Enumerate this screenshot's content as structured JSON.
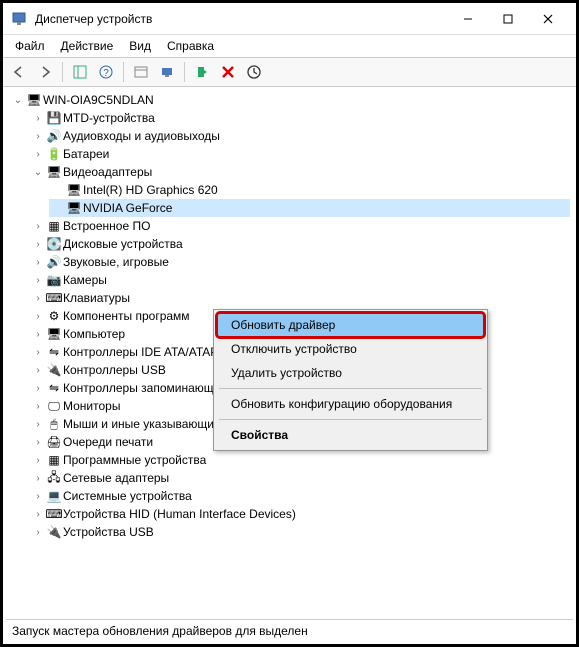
{
  "window": {
    "title": "Диспетчер устройств"
  },
  "menubar": {
    "file": "Файл",
    "action": "Действие",
    "view": "Вид",
    "help": "Справка"
  },
  "tree": {
    "root": "WIN-OIA9C5NDLAN",
    "categories": [
      {
        "label": "MTD-устройства",
        "icon": "💾"
      },
      {
        "label": "Аудиовходы и аудиовыходы",
        "icon": "🔊"
      },
      {
        "label": "Батареи",
        "icon": "🔋"
      },
      {
        "label": "Видеоадаптеры",
        "icon": "🖥",
        "expanded": true,
        "children": [
          {
            "label": "Intel(R) HD Graphics 620"
          },
          {
            "label": "NVIDIA GeForce",
            "selected": true
          }
        ]
      },
      {
        "label": "Встроенное ПО",
        "icon": "▦"
      },
      {
        "label": "Дисковые устройства",
        "icon": "💽"
      },
      {
        "label": "Звуковые, игровые",
        "icon": "🔊"
      },
      {
        "label": "Камеры",
        "icon": "📷"
      },
      {
        "label": "Клавиатуры",
        "icon": "⌨"
      },
      {
        "label": "Компоненты программ",
        "icon": "⚙"
      },
      {
        "label": "Компьютер",
        "icon": "🖥"
      },
      {
        "label": "Контроллеры IDE ATA/ATAPI",
        "icon": "⇋"
      },
      {
        "label": "Контроллеры USB",
        "icon": "🔌"
      },
      {
        "label": "Контроллеры запоминающих устройств",
        "icon": "⇋"
      },
      {
        "label": "Мониторы",
        "icon": "🖵"
      },
      {
        "label": "Мыши и иные указывающие устройства",
        "icon": "🖱"
      },
      {
        "label": "Очереди печати",
        "icon": "🖨"
      },
      {
        "label": "Программные устройства",
        "icon": "▦"
      },
      {
        "label": "Сетевые адаптеры",
        "icon": "🖧"
      },
      {
        "label": "Системные устройства",
        "icon": "💻"
      },
      {
        "label": "Устройства HID (Human Interface Devices)",
        "icon": "⌨"
      },
      {
        "label": "Устройства USB",
        "icon": "🔌"
      }
    ]
  },
  "context_menu": {
    "update_driver": "Обновить драйвер",
    "disable_device": "Отключить устройство",
    "uninstall_device": "Удалить устройство",
    "scan_hardware": "Обновить конфигурацию оборудования",
    "properties": "Свойства"
  },
  "status_text": "Запуск мастера обновления драйверов для выделен"
}
